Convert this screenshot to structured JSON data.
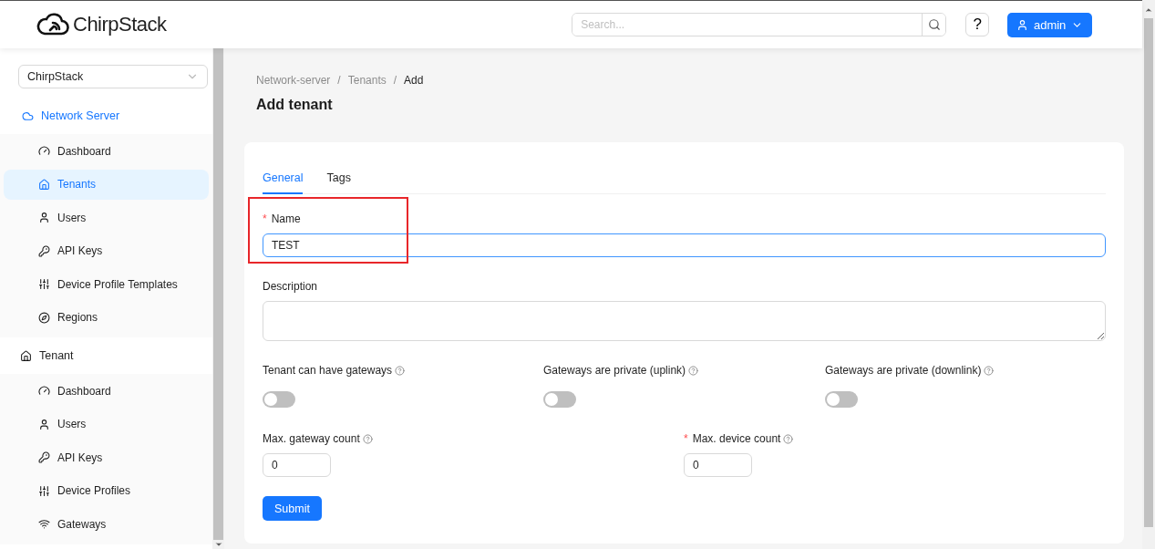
{
  "header": {
    "logo": "ChirpStack",
    "search": {
      "placeholder": "Search..."
    },
    "help": "?",
    "user": "admin"
  },
  "sidebar": {
    "tenant_select": "ChirpStack",
    "sections": [
      {
        "label": "Network Server",
        "active": true,
        "items": [
          {
            "label": "Dashboard",
            "selected": false
          },
          {
            "label": "Tenants",
            "selected": true
          },
          {
            "label": "Users",
            "selected": false
          },
          {
            "label": "API Keys",
            "selected": false
          },
          {
            "label": "Device Profile Templates",
            "selected": false
          },
          {
            "label": "Regions",
            "selected": false
          }
        ]
      },
      {
        "label": "Tenant",
        "active": false,
        "items": [
          {
            "label": "Dashboard",
            "selected": false
          },
          {
            "label": "Users",
            "selected": false
          },
          {
            "label": "API Keys",
            "selected": false
          },
          {
            "label": "Device Profiles",
            "selected": false
          },
          {
            "label": "Gateways",
            "selected": false
          }
        ]
      }
    ]
  },
  "breadcrumb": [
    "Network-server",
    "Tenants",
    "Add"
  ],
  "breadcrumb_separator": "/",
  "required_mark": "*",
  "title": "Add tenant",
  "tabs": [
    {
      "label": "General",
      "selected": true
    },
    {
      "label": "Tags",
      "selected": false
    }
  ],
  "form": {
    "name": {
      "label": "Name",
      "required": true,
      "value": "TEST"
    },
    "description": {
      "label": "Description"
    },
    "switches": [
      {
        "label": "Tenant can have gateways",
        "on": false
      },
      {
        "label": "Gateways are private (uplink)",
        "on": false
      },
      {
        "label": "Gateways are private (downlink)",
        "on": false
      }
    ],
    "counts": [
      {
        "label": "Max. gateway count",
        "required": false,
        "value": "0"
      },
      {
        "label": "Max. device count",
        "required": true,
        "value": "0"
      }
    ],
    "submit": "Submit"
  }
}
